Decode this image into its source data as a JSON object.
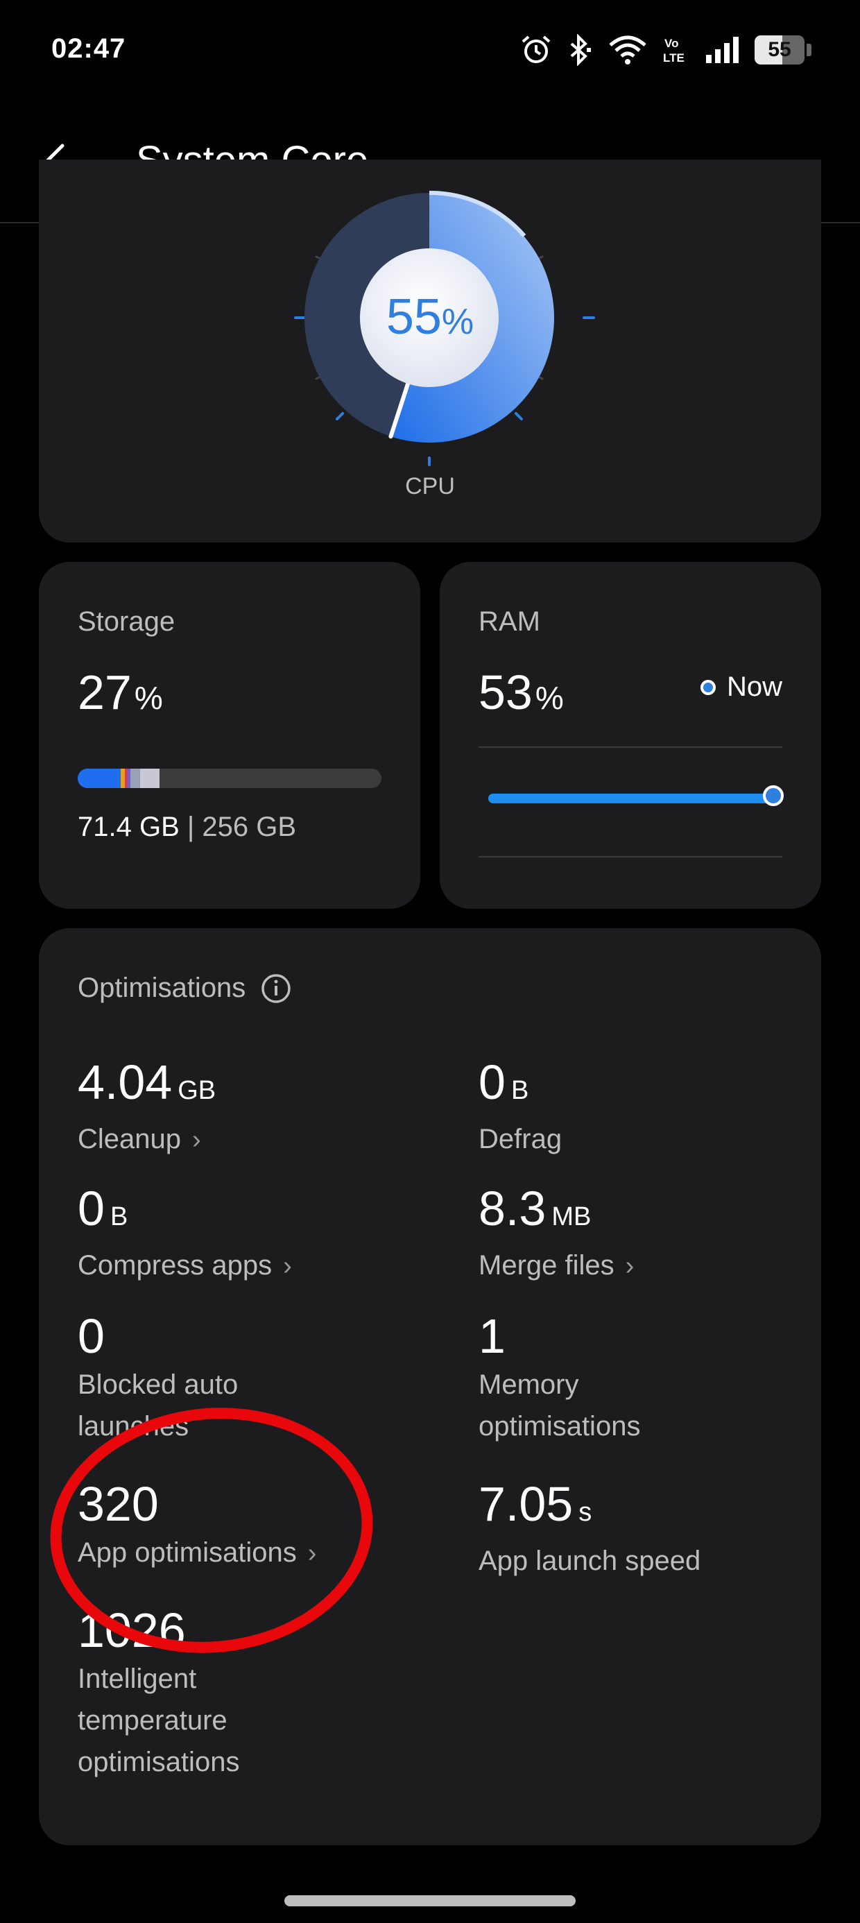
{
  "status_bar": {
    "time": "02:47",
    "network_label": "Vo LTE",
    "battery": "55",
    "battery_level": 0.55,
    "icons": [
      "alarm-icon",
      "bluetooth-icon",
      "wifi-icon",
      "volte-icon",
      "signal-icon",
      "battery-icon"
    ]
  },
  "header": {
    "title": "System Core"
  },
  "cpu": {
    "value": "55",
    "unit": "%",
    "label": "CPU",
    "level": 0.55
  },
  "storage": {
    "label": "Storage",
    "percent": "27",
    "unit": "%",
    "used": "71.4 GB",
    "separator": "|",
    "total": "256 GB",
    "fill": 0.27
  },
  "ram": {
    "label": "RAM",
    "percent": "53",
    "unit": "%",
    "now_label": "Now"
  },
  "optimisations": {
    "title": "Optimisations",
    "stats": [
      {
        "value": "4.04",
        "unit": "GB",
        "label": "Cleanup",
        "has_chevron": true
      },
      {
        "value": "0",
        "unit": "B",
        "label": "Defrag",
        "has_chevron": false
      },
      {
        "value": "0",
        "unit": "B",
        "label": "Compress apps",
        "has_chevron": true
      },
      {
        "value": "8.3",
        "unit": "MB",
        "label": "Merge files",
        "has_chevron": true
      },
      {
        "value": "0",
        "unit": "",
        "label_line1": "Blocked auto",
        "label_line2": "launches",
        "has_chevron": false
      },
      {
        "value": "1",
        "unit": "",
        "label_line1": "Memory",
        "label_line2": "optimisations",
        "has_chevron": false
      },
      {
        "value": "320",
        "unit": "",
        "label": "App optimisations",
        "has_chevron": true
      },
      {
        "value": "7.05",
        "unit": "s",
        "label": "App launch speed",
        "has_chevron": false
      },
      {
        "value": "1026",
        "unit": "",
        "label_line1": "Intelligent",
        "label_line2": "temperature",
        "label_line3": "optimisations",
        "has_chevron": false
      }
    ]
  },
  "colors": {
    "background": "#000000",
    "card": "#1c1c1e",
    "accent_blue": "#2f7fe0",
    "annotation_red": "#e8070b"
  }
}
